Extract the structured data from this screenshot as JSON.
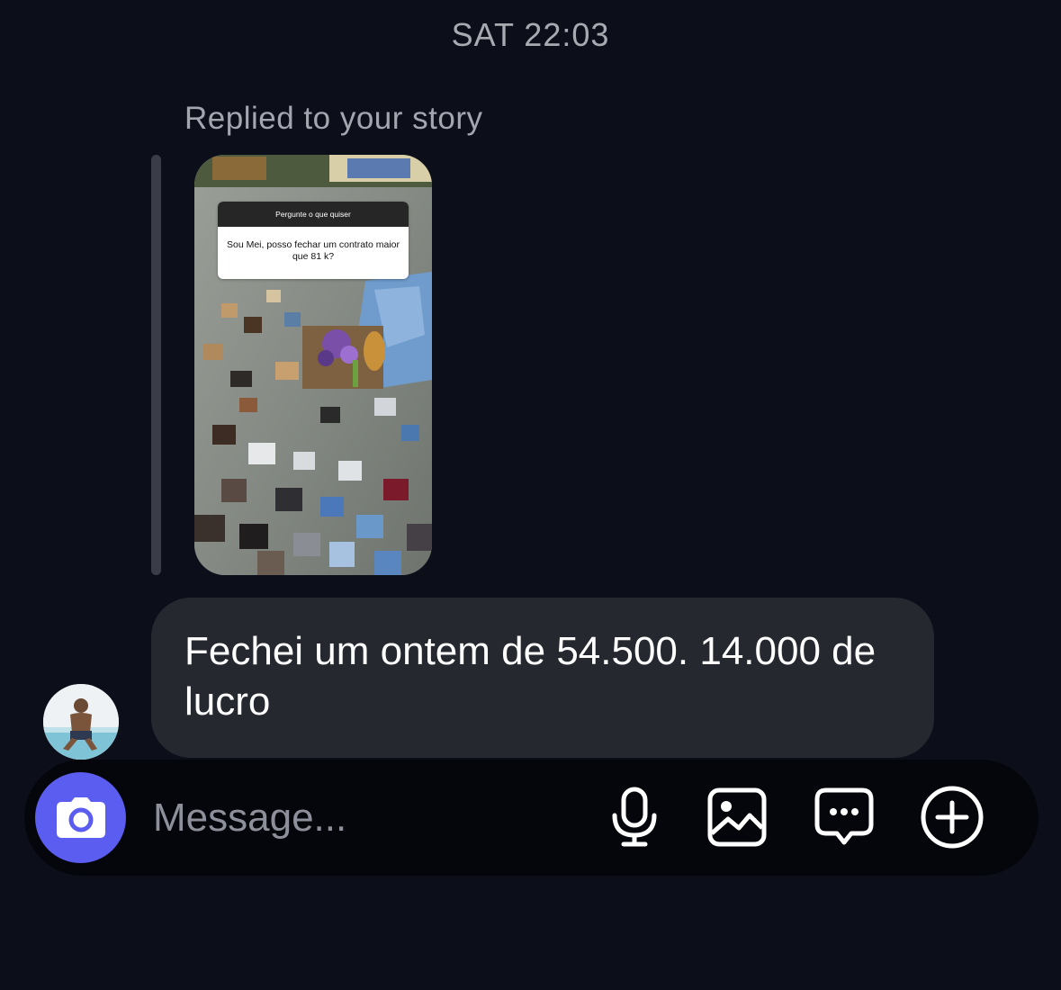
{
  "thread": {
    "timestamp": "SAT 22:03",
    "reply_caption": "Replied to your story"
  },
  "story": {
    "question_header": "Pergunte o que quiser",
    "question_text": "Sou Mei, posso fechar um contrato maior que 81 k?"
  },
  "message": {
    "text": "Fechei um ontem de 54.500. 14.000 de lucro"
  },
  "composer": {
    "placeholder": "Message...",
    "icons": [
      "camera-icon",
      "microphone-icon",
      "gallery-icon",
      "sticker-icon",
      "add-icon"
    ],
    "accent_color": "#5b5cf0"
  }
}
